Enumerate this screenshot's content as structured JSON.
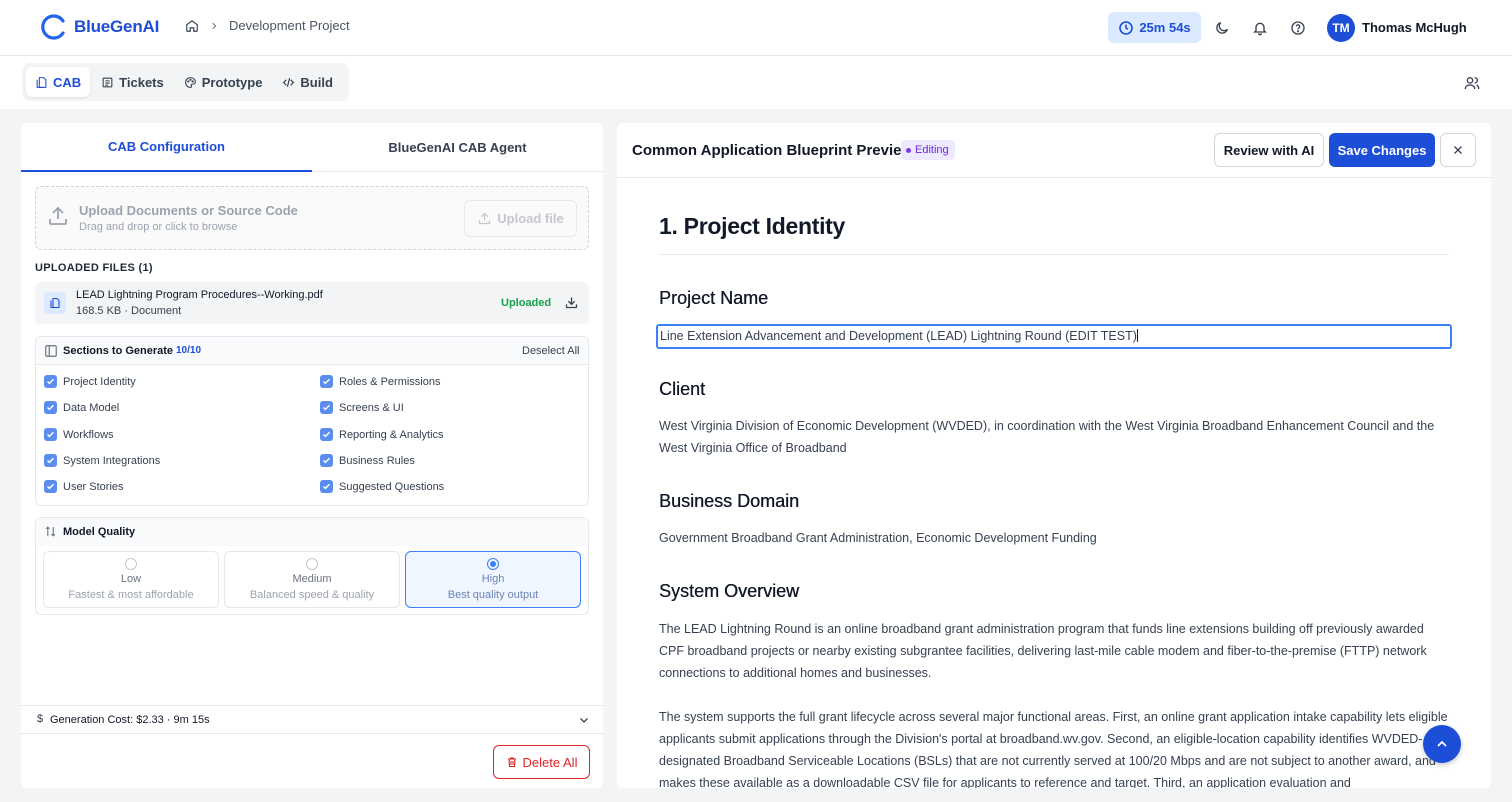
{
  "app": {
    "name": "BlueGenAI"
  },
  "breadcrumb": {
    "project": "Development Project"
  },
  "header": {
    "timer": "25m 54s",
    "avatar_initials": "TM",
    "user_name": "Thomas McHugh"
  },
  "nav": {
    "tabs": [
      "CAB",
      "Tickets",
      "Prototype",
      "Build"
    ],
    "active": "CAB"
  },
  "left_panel": {
    "tabs": [
      "CAB Configuration",
      "BlueGenAI CAB Agent"
    ],
    "upload": {
      "title": "Upload Documents or Source Code",
      "subtitle": "Drag and drop or click to browse",
      "button": "Upload file"
    },
    "files_heading": "UPLOADED FILES (1)",
    "file": {
      "name": "LEAD Lightning Program Procedures--Working.pdf",
      "meta": "168.5 KB · Document",
      "status": "Uploaded"
    },
    "sections": {
      "title": "Sections to Generate",
      "count": "10/10",
      "deselect": "Deselect All",
      "items": [
        "Project Identity",
        "Roles & Permissions",
        "Data Model",
        "Screens & UI",
        "Workflows",
        "Reporting & Analytics",
        "System Integrations",
        "Business Rules",
        "User Stories",
        "Suggested Questions"
      ]
    },
    "quality": {
      "title": "Model Quality",
      "options": [
        {
          "label": "Low",
          "desc": "Fastest & most affordable"
        },
        {
          "label": "Medium",
          "desc": "Balanced speed & quality"
        },
        {
          "label": "High",
          "desc": "Best quality output"
        }
      ],
      "selected": "High"
    },
    "cost": "Generation Cost: $2.33 · 9m 15s",
    "cost_symbol": "$",
    "delete_button": "Delete All"
  },
  "preview": {
    "title": "Common Application Blueprint Preview",
    "badge": "Editing",
    "review_button": "Review with AI",
    "save_button": "Save Changes",
    "section_heading": "1. Project Identity",
    "project_name_label": "Project Name",
    "project_name_value": "Line Extension Advancement and Development (LEAD) Lightning Round (EDIT TEST)",
    "client_label": "Client",
    "client_text": "West Virginia Division of Economic Development (WVDED), in coordination with the West Virginia Broadband Enhancement Council and the West Virginia Office of Broadband",
    "domain_label": "Business Domain",
    "domain_text": "Government Broadband Grant Administration, Economic Development Funding",
    "overview_label": "System Overview",
    "overview_p1": "The LEAD Lightning Round is an online broadband grant administration program that funds line extensions building off previously awarded CPF broadband projects or nearby existing subgrantee facilities, delivering last-mile cable modem and fiber-to-the-premise (FTTP) network connections to additional homes and businesses.",
    "overview_p2": "The system supports the full grant lifecycle across several major functional areas. First, an online grant application intake capability lets eligible applicants submit applications through the Division's portal at broadband.wv.gov. Second, an eligible-location capability identifies WVDED-designated Broadband Serviceable Locations (BSLs) that are not currently served at 100/20 Mbps and are not subject to another award, and makes these available as a downloadable CSV file for applicants to reference and target. Third, an application evaluation and"
  },
  "colors": {
    "accent": "#1d4ed8",
    "success": "#16a34a",
    "danger": "#dc2626",
    "badge": "#7c3aed"
  },
  "icons": [
    "logo-ring-icon",
    "home-icon",
    "chevron-right-icon",
    "clock-icon",
    "moon-icon",
    "bell-icon",
    "help-icon",
    "document-icon",
    "list-icon",
    "palette-icon",
    "code-icon",
    "users-icon",
    "upload-icon",
    "download-icon",
    "panel-icon",
    "sort-icon",
    "chevron-down-icon",
    "trash-icon",
    "close-icon",
    "arrow-up-icon"
  ]
}
